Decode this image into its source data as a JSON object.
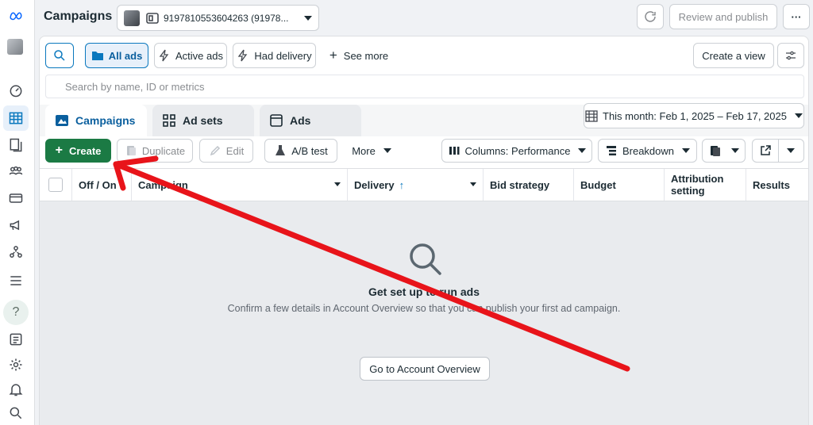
{
  "header": {
    "title": "Campaigns",
    "account_label": "9197810553604263 (91978...",
    "review_publish": "Review and publish",
    "more": "···"
  },
  "filters": {
    "all_ads": "All ads",
    "active_ads": "Active ads",
    "had_delivery": "Had delivery",
    "see_more": "See more",
    "create_view": "Create a view"
  },
  "search": {
    "placeholder": "Search by name, ID or metrics"
  },
  "tabs": [
    {
      "label": "Campaigns"
    },
    {
      "label": "Ad sets"
    },
    {
      "label": "Ads"
    }
  ],
  "date_range": "This month: Feb 1, 2025 – Feb 17, 2025",
  "toolbar": {
    "create": "Create",
    "duplicate": "Duplicate",
    "edit": "Edit",
    "ab_test": "A/B test",
    "more": "More",
    "columns": "Columns: Performance",
    "breakdown": "Breakdown"
  },
  "table": {
    "columns": [
      "Off / On",
      "Campaign",
      "Delivery",
      "Bid strategy",
      "Budget",
      "Attribution setting",
      "Results"
    ],
    "delivery_sort": "↑"
  },
  "empty_state": {
    "title": "Get set up to run ads",
    "description": "Confirm a few details in Account Overview so that you can publish your first ad campaign.",
    "button": "Go to Account Overview"
  },
  "colors": {
    "create_green": "#1b7a44",
    "accent_blue": "#0a78be",
    "annotation_red": "#e8141a"
  }
}
